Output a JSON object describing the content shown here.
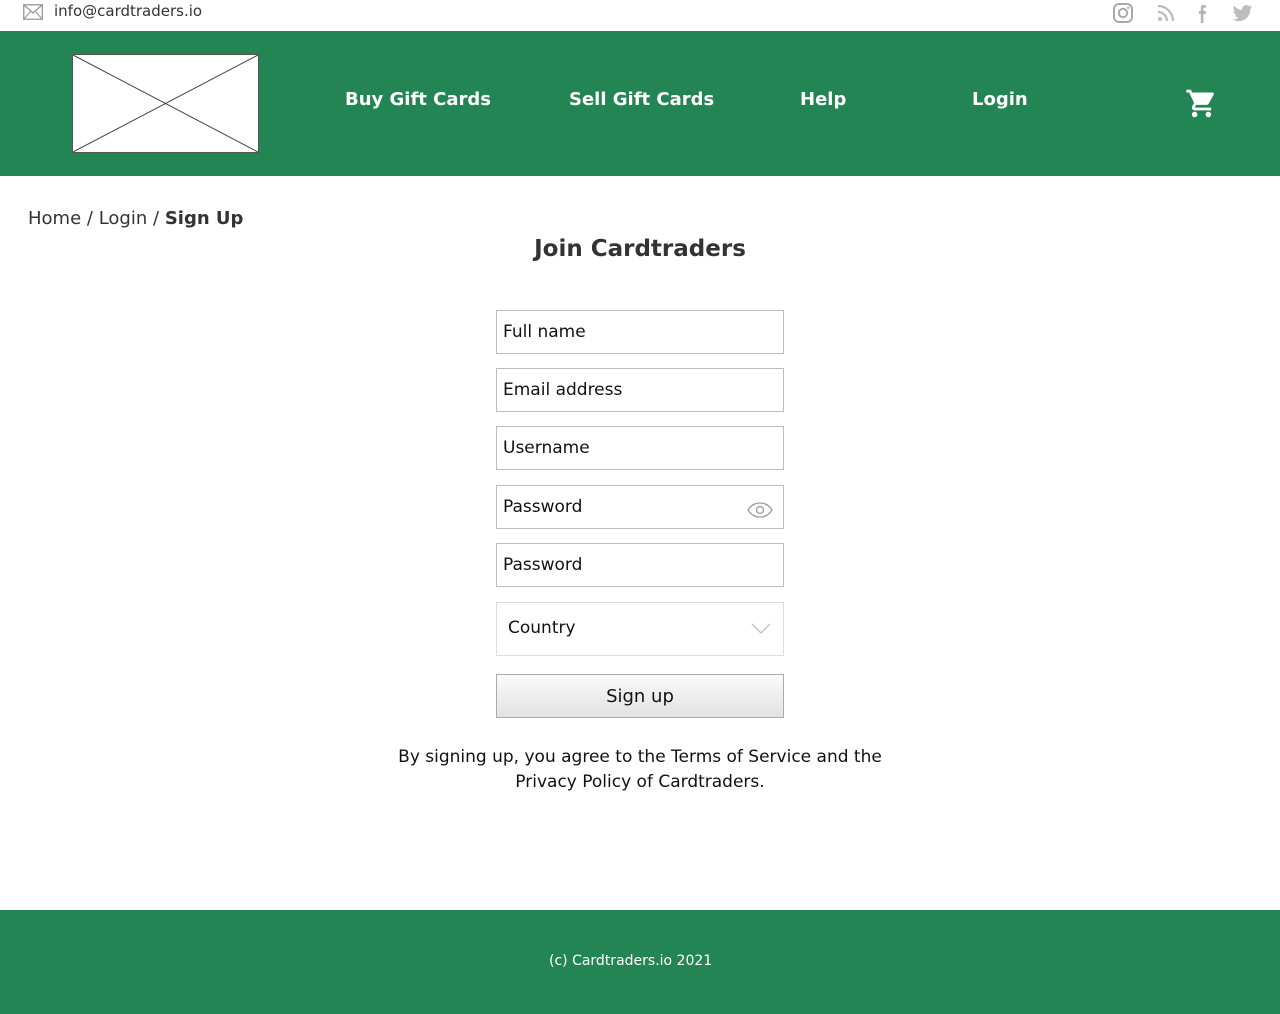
{
  "topbar": {
    "email": "info@cardtraders.io",
    "mail_icon": "envelope-icon",
    "social_icons": [
      "instagram-icon",
      "rss-icon",
      "facebook-icon",
      "twitter-icon"
    ]
  },
  "header": {
    "logo": "logo-placeholder",
    "nav": {
      "buy": "Buy Gift Cards",
      "sell": "Sell Gift Cards",
      "help": "Help",
      "login": "Login"
    },
    "cart_icon": "shopping-cart-icon"
  },
  "breadcrumb": {
    "home": "Home",
    "login": "Login",
    "current": "Sign Up",
    "separator": "/"
  },
  "form": {
    "title": "Join Cardtraders",
    "full_name_placeholder": "Full name",
    "email_placeholder": "Email address",
    "username_placeholder": "Username",
    "password_placeholder": "Password",
    "password_confirm_placeholder": "Password",
    "country": "Country",
    "submit_label": "Sign up",
    "terms_line1": "By signing up, you agree to the Terms of Service and the",
    "terms_line2": "Privacy Policy of Cardtraders."
  },
  "footer": {
    "copyright": "(c) Cardtraders.io 2021"
  },
  "colors": {
    "brand_green": "#238553",
    "white": "#ffffff",
    "icon_gray": "#b5b5b5"
  }
}
